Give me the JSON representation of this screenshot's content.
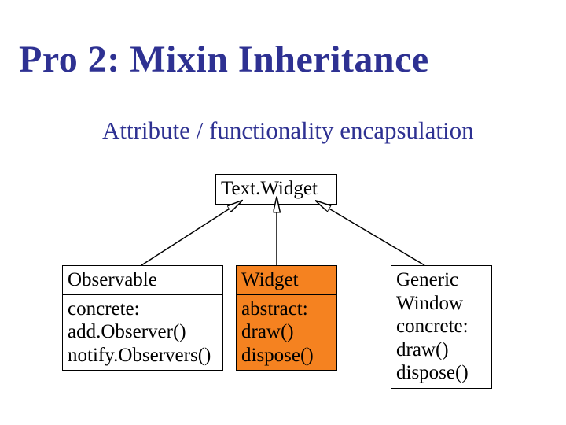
{
  "title": "Pro 2: Mixin Inheritance",
  "subtitle": "Attribute / functionality encapsulation",
  "boxes": {
    "textwidget": {
      "name": "Text.Widget"
    },
    "observable": {
      "name": "Observable",
      "section_label": "concrete:",
      "method1": "add.Observer()",
      "method2": "notify.Observers()"
    },
    "widget": {
      "name": "Widget",
      "section_label": "abstract:",
      "method1": "draw()",
      "method2": "dispose()"
    },
    "generic": {
      "line1": "Generic",
      "line2": "Window",
      "section_label": "concrete:",
      "method1": "draw()",
      "method2": "dispose()"
    }
  }
}
